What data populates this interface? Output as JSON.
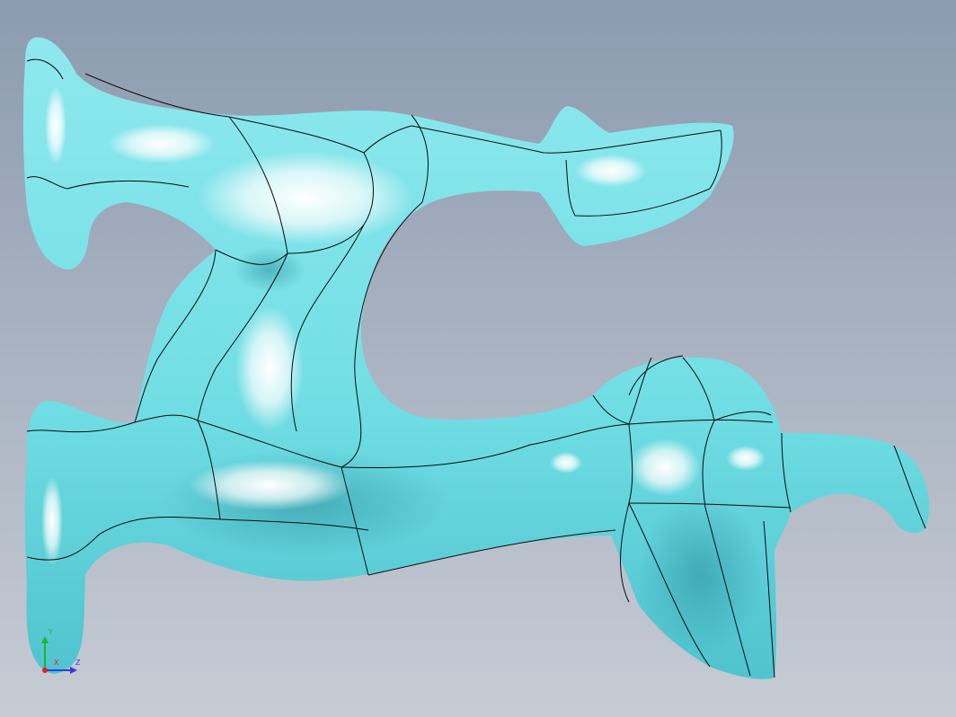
{
  "viewport": {
    "background_top": "#8c9bb0",
    "background_bottom": "#c7ccd4",
    "model_color": "#72dfe5",
    "model_highlight": "#ffffff",
    "model_shadow": "#3aa9b7",
    "edge_color": "#0b0b0b"
  },
  "triad": {
    "y_label": "Y",
    "x_label": "X",
    "z_label": "Z",
    "colors": {
      "x": "#e62020",
      "y": "#1fb52a",
      "z": "#2f3de0"
    }
  }
}
